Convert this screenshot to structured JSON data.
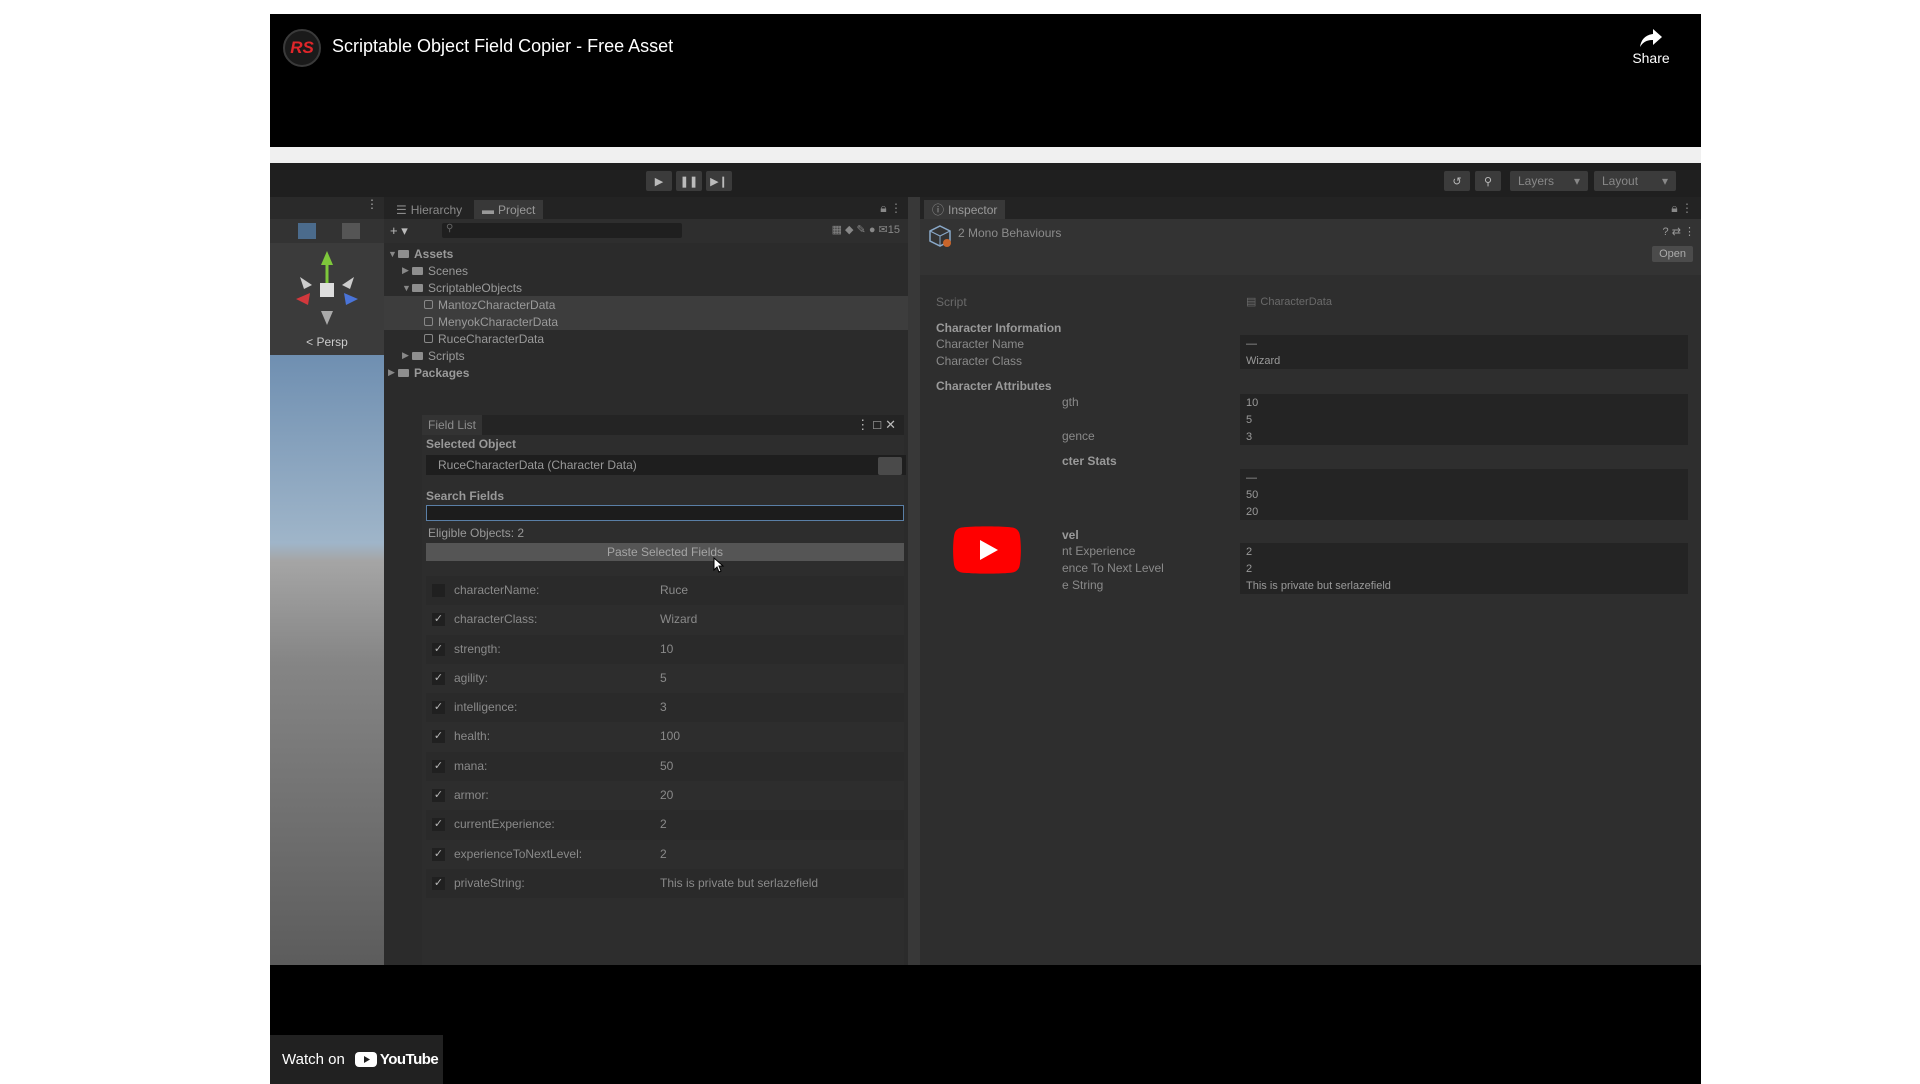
{
  "embed": {
    "channel_logo_text": "RS",
    "title": "Scriptable Object Field Copier - Free Asset",
    "share_label": "Share",
    "watch_on_label": "Watch on",
    "youtube_label": "YouTube",
    "play_button_color": "#ff0000"
  },
  "unity": {
    "toolbar": {
      "layers_label": "Layers",
      "layout_label": "Layout"
    },
    "scene": {
      "persp_label": "< Persp"
    },
    "project_panel": {
      "tabs": [
        "Hierarchy",
        "Project"
      ],
      "counter": "15",
      "tree": [
        {
          "label": "Assets",
          "bold": true
        },
        {
          "label": "Scenes"
        },
        {
          "label": "ScriptableObjects"
        },
        {
          "label": "MantozCharacterData"
        },
        {
          "label": "MenyokCharacterData"
        },
        {
          "label": "RuceCharacterData"
        },
        {
          "label": "Scripts"
        },
        {
          "label": "Packages",
          "bold": true
        }
      ]
    },
    "field_list": {
      "tab_label": "Field List",
      "selected_object_label": "Selected Object",
      "selected_object_value": "RuceCharacterData (Character Data)",
      "search_label": "Search Fields",
      "search_value": "",
      "eligible_label": "Eligible Objects: 2",
      "paste_button": "Paste Selected Fields",
      "fields": [
        {
          "name": "characterName:",
          "value": "Ruce",
          "checked": false
        },
        {
          "name": "characterClass:",
          "value": "Wizard",
          "checked": true
        },
        {
          "name": "strength:",
          "value": "10",
          "checked": true
        },
        {
          "name": "agility:",
          "value": "5",
          "checked": true
        },
        {
          "name": "intelligence:",
          "value": "3",
          "checked": true
        },
        {
          "name": "health:",
          "value": "100",
          "checked": true
        },
        {
          "name": "mana:",
          "value": "50",
          "checked": true
        },
        {
          "name": "armor:",
          "value": "20",
          "checked": true
        },
        {
          "name": "currentExperience:",
          "value": "2",
          "checked": true
        },
        {
          "name": "experienceToNextLevel:",
          "value": "2",
          "checked": true
        },
        {
          "name": "privateString:",
          "value": "This is private but serlazefield",
          "checked": true
        }
      ]
    },
    "inspector": {
      "tab_label": "Inspector",
      "header_label": "2 Mono Behaviours",
      "open_button": "Open",
      "script_label": "Script",
      "script_value": "CharacterData",
      "char_info_header": "Character Information",
      "char_name_label": "Character Name",
      "char_name_value": "—",
      "char_class_label": "Character Class",
      "char_class_value": "Wizard",
      "attributes_header": "Character Attributes",
      "strength_label": "gth",
      "strength_value": "10",
      "agility_value": "5",
      "intelligence_label": "gence",
      "intelligence_value": "3",
      "stats_header": "cter Stats",
      "health_value": "—",
      "mana_value": "50",
      "armor_value": "20",
      "level_header": "vel",
      "cur_exp_label": "nt Experience",
      "cur_exp_value": "2",
      "next_level_label": "ence To Next Level",
      "next_level_value": "2",
      "private_label": "e String",
      "private_value": "This is private but serlazefield"
    }
  }
}
